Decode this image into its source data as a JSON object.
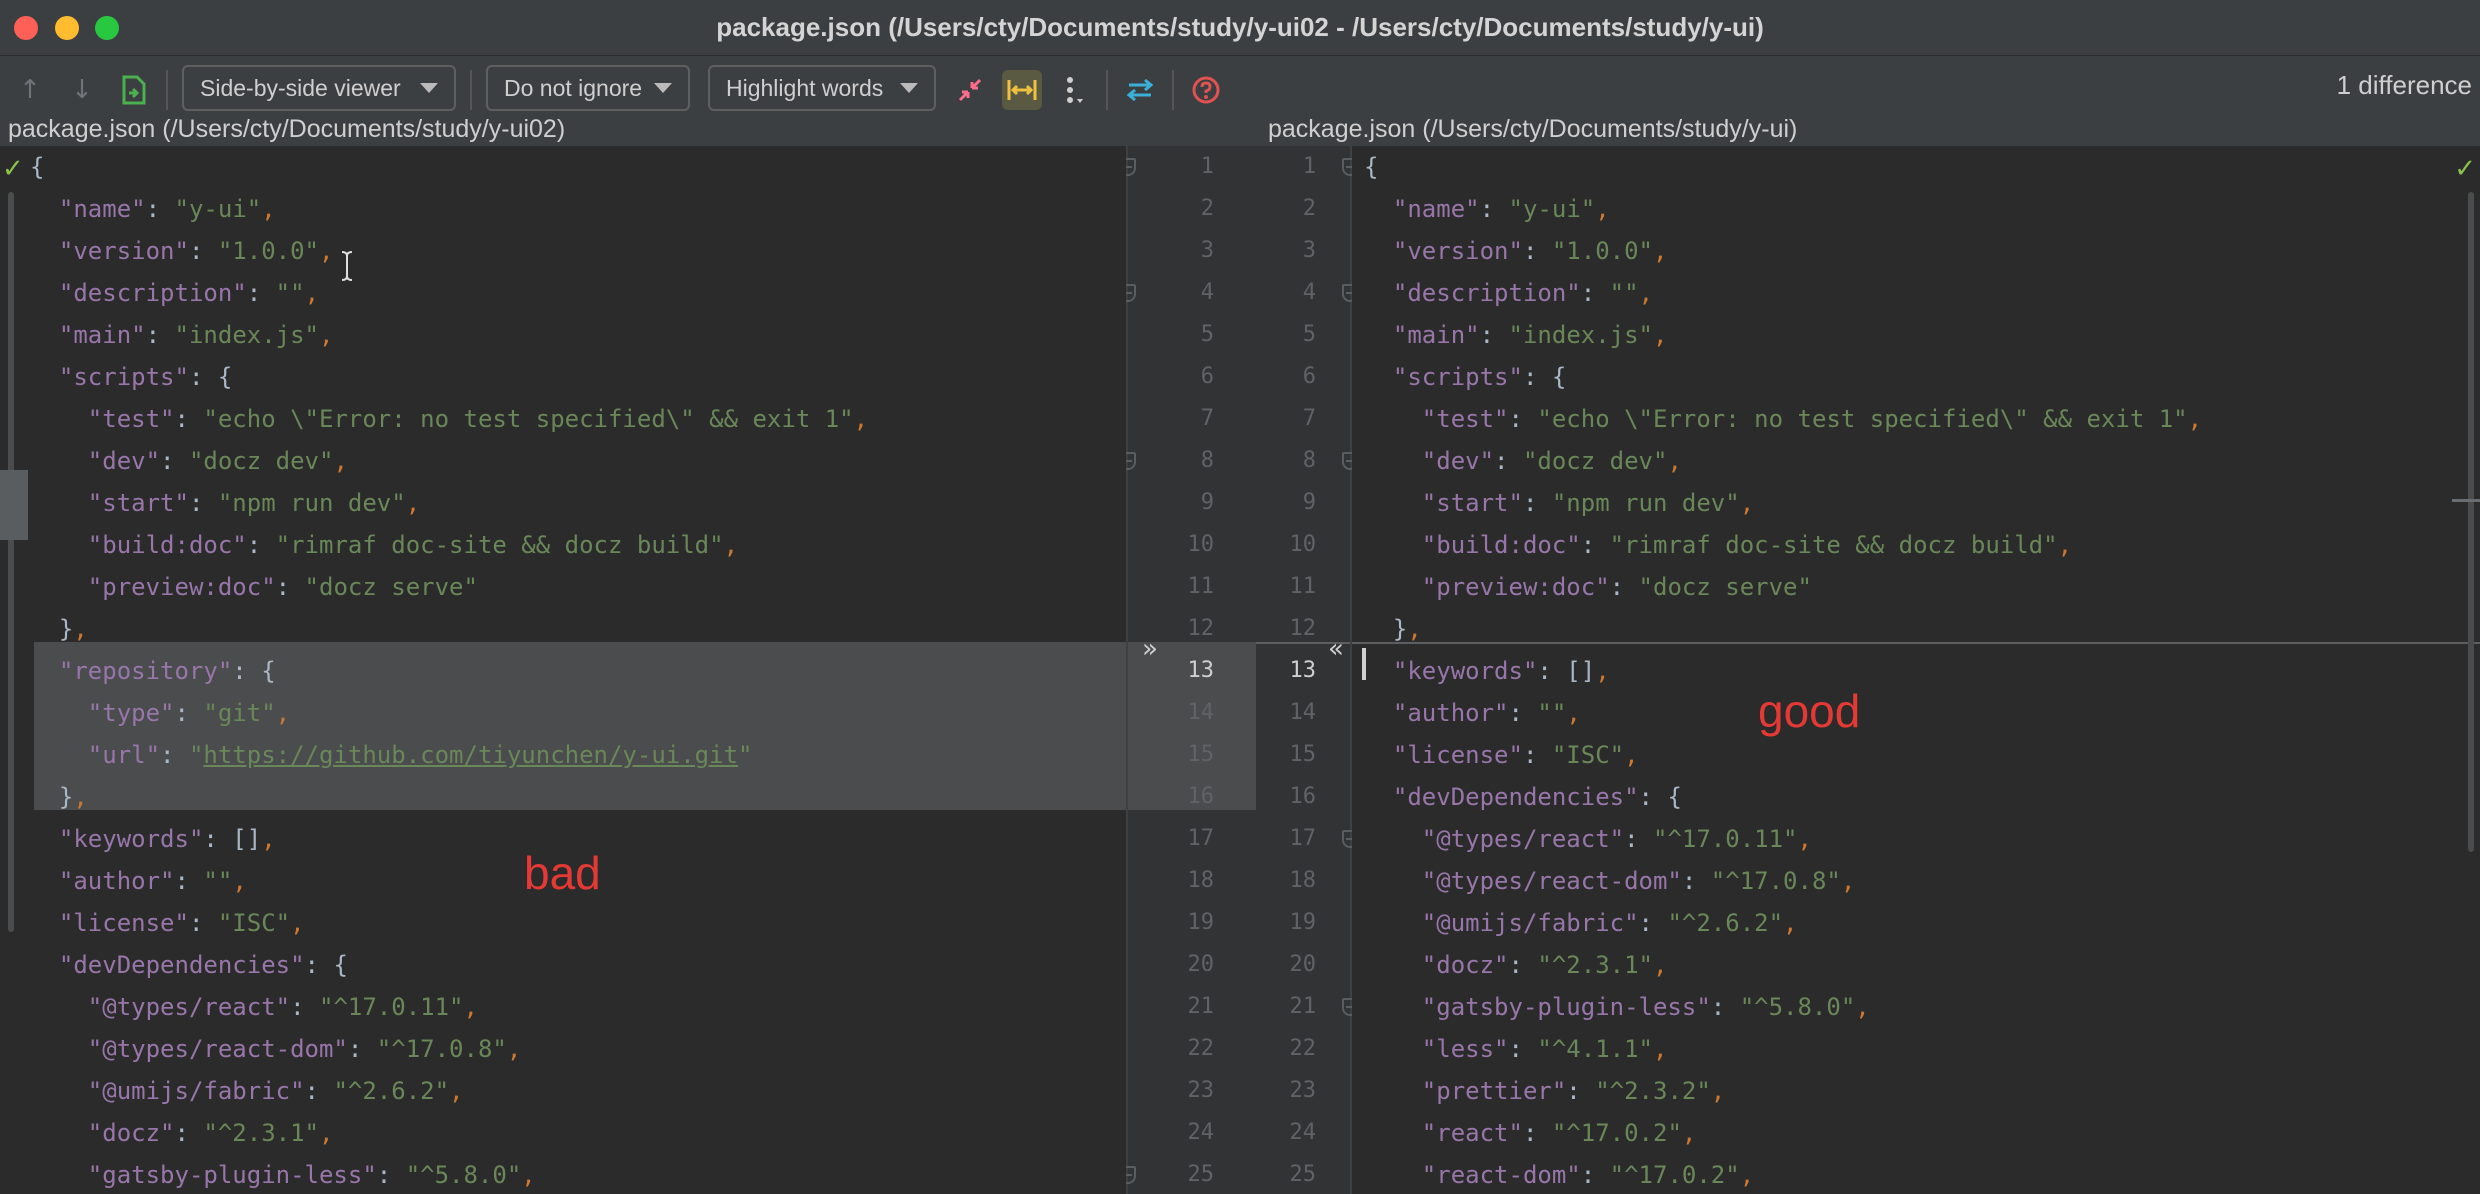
{
  "window": {
    "title": "package.json (/Users/cty/Documents/study/y-ui02 - /Users/cty/Documents/study/y-ui)"
  },
  "toolbar": {
    "viewer_mode": "Side-by-side viewer",
    "ignore_mode": "Do not ignore",
    "highlight_mode": "Highlight words",
    "difference_count": "1 difference",
    "icons": [
      "arrow-up-icon",
      "arrow-down-icon",
      "jump-to-source-icon",
      "collapse-unchanged-icon",
      "sync-scroll-icon",
      "more-icon",
      "swap-sides-icon",
      "help-icon"
    ]
  },
  "left": {
    "path": "package.json (/Users/cty/Documents/study/y-ui02)",
    "annotation": "bad",
    "lines": [
      "{",
      "  \"name\": \"y-ui\",",
      "  \"version\": \"1.0.0\",",
      "  \"description\": \"\",",
      "  \"main\": \"index.js\",",
      "  \"scripts\": {",
      "    \"test\": \"echo \\\"Error: no test specified\\\" && exit 1\",",
      "    \"dev\": \"docz dev\",",
      "    \"start\": \"npm run dev\",",
      "    \"build:doc\": \"rimraf doc-site && docz build\",",
      "    \"preview:doc\": \"docz serve\"",
      "  },",
      "  \"repository\": {",
      "    \"type\": \"git\",",
      "    \"url\": \"https://github.com/tiyunchen/y-ui.git\"",
      "  },",
      "  \"keywords\": [],",
      "  \"author\": \"\",",
      "  \"license\": \"ISC\",",
      "  \"devDependencies\": {",
      "    \"@types/react\": \"^17.0.11\",",
      "    \"@types/react-dom\": \"^17.0.8\",",
      "    \"@umijs/fabric\": \"^2.6.2\",",
      "    \"docz\": \"^2.3.1\",",
      "    \"gatsby-plugin-less\": \"^5.8.0\","
    ],
    "line_numbers": [
      "1",
      "2",
      "3",
      "4",
      "5",
      "6",
      "7",
      "8",
      "9",
      "10",
      "11",
      "12",
      "13",
      "14",
      "15",
      "16",
      "17",
      "18",
      "19",
      "20",
      "21",
      "22",
      "23",
      "24",
      "25"
    ]
  },
  "right": {
    "path": "package.json (/Users/cty/Documents/study/y-ui)",
    "annotation": "good",
    "lines": [
      "{",
      "  \"name\": \"y-ui\",",
      "  \"version\": \"1.0.0\",",
      "  \"description\": \"\",",
      "  \"main\": \"index.js\",",
      "  \"scripts\": {",
      "    \"test\": \"echo \\\"Error: no test specified\\\" && exit 1\",",
      "    \"dev\": \"docz dev\",",
      "    \"start\": \"npm run dev\",",
      "    \"build:doc\": \"rimraf doc-site && docz build\",",
      "    \"preview:doc\": \"docz serve\"",
      "  },",
      "  \"keywords\": [],",
      "  \"author\": \"\",",
      "  \"license\": \"ISC\",",
      "  \"devDependencies\": {",
      "    \"@types/react\": \"^17.0.11\",",
      "    \"@types/react-dom\": \"^17.0.8\",",
      "    \"@umijs/fabric\": \"^2.6.2\",",
      "    \"docz\": \"^2.3.1\",",
      "    \"gatsby-plugin-less\": \"^5.8.0\",",
      "    \"less\": \"^4.1.1\",",
      "    \"prettier\": \"^2.3.2\",",
      "    \"react\": \"^17.0.2\",",
      "    \"react-dom\": \"^17.0.2\","
    ],
    "line_numbers": [
      "1",
      "2",
      "3",
      "4",
      "5",
      "6",
      "7",
      "8",
      "9",
      "10",
      "11",
      "12",
      "13",
      "14",
      "15",
      "16",
      "17",
      "18",
      "19",
      "20",
      "21",
      "22",
      "23",
      "24",
      "25"
    ]
  },
  "colors": {
    "key": "#9876aa",
    "string": "#6a8759",
    "punct": "#a9b7c6",
    "comma": "#cc7832",
    "annotation": "#e53935",
    "check": "#8bc34a"
  }
}
